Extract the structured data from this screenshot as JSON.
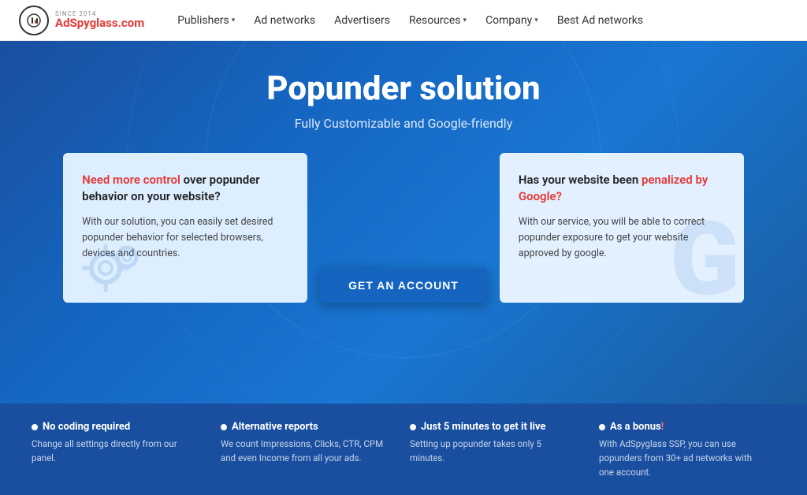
{
  "logo": {
    "since": "SINCE 2014",
    "name_prefix": "Ad",
    "name_highlight": "Spyglass",
    "name_suffix": ".com"
  },
  "nav": {
    "items": [
      {
        "label": "Publishers",
        "has_dropdown": true
      },
      {
        "label": "Ad networks",
        "has_dropdown": false
      },
      {
        "label": "Advertisers",
        "has_dropdown": false
      },
      {
        "label": "Resources",
        "has_dropdown": true
      },
      {
        "label": "Company",
        "has_dropdown": true
      },
      {
        "label": "Best Ad networks",
        "has_dropdown": false
      }
    ]
  },
  "hero": {
    "title": "Popunder solution",
    "subtitle": "Fully Customizable and Google-friendly"
  },
  "card_left": {
    "heading_highlight": "Need more control",
    "heading_rest": " over popunder behavior on your website?",
    "body": "With our solution, you can easily set desired popunder behavior for selected browsers, devices and countries."
  },
  "card_right": {
    "heading_plain": "Has your website been ",
    "heading_highlight": "penalized by Google?",
    "body": "With our service, you will be able to correct popunder exposure to get your website approved by google."
  },
  "cta": {
    "button_label": "GET AN ACCOUNT"
  },
  "features": [
    {
      "title": "No coding required",
      "desc": "Change all settings directly from our panel."
    },
    {
      "title": "Alternative reports",
      "desc": "We count Impressions, Clicks, CTR, CPM and even Income from all your ads."
    },
    {
      "title": "Just 5 minutes to get it live",
      "desc": "Setting up popunder takes only 5 minutes."
    },
    {
      "title_prefix": "As a bonus",
      "title_suffix": "!",
      "desc": "With AdSpyglass SSP, you can use popunders from 30+ ad networks with one account."
    }
  ]
}
